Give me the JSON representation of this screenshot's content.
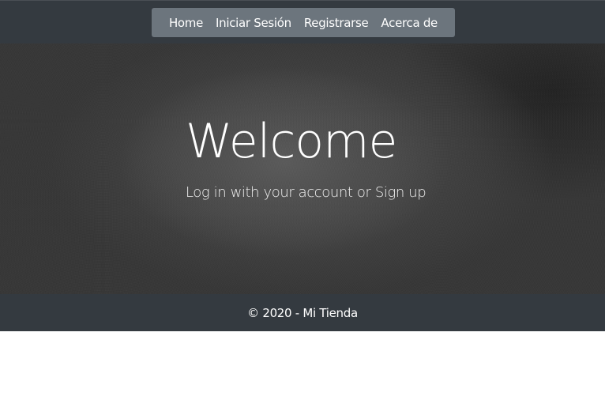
{
  "nav": {
    "items": [
      {
        "label": "Home"
      },
      {
        "label": "Iniciar Sesión"
      },
      {
        "label": "Registrarse"
      },
      {
        "label": "Acerca de"
      }
    ]
  },
  "hero": {
    "title": "Welcome",
    "subtitle": "Log in with your account or Sign up"
  },
  "footer": {
    "copyright": "© 2020 - Mi Tienda"
  },
  "colors": {
    "navbar_bg": "#343a40",
    "nav_pill_bg": "#6c757d",
    "hero_bg": "#363636",
    "text": "#ffffff"
  }
}
